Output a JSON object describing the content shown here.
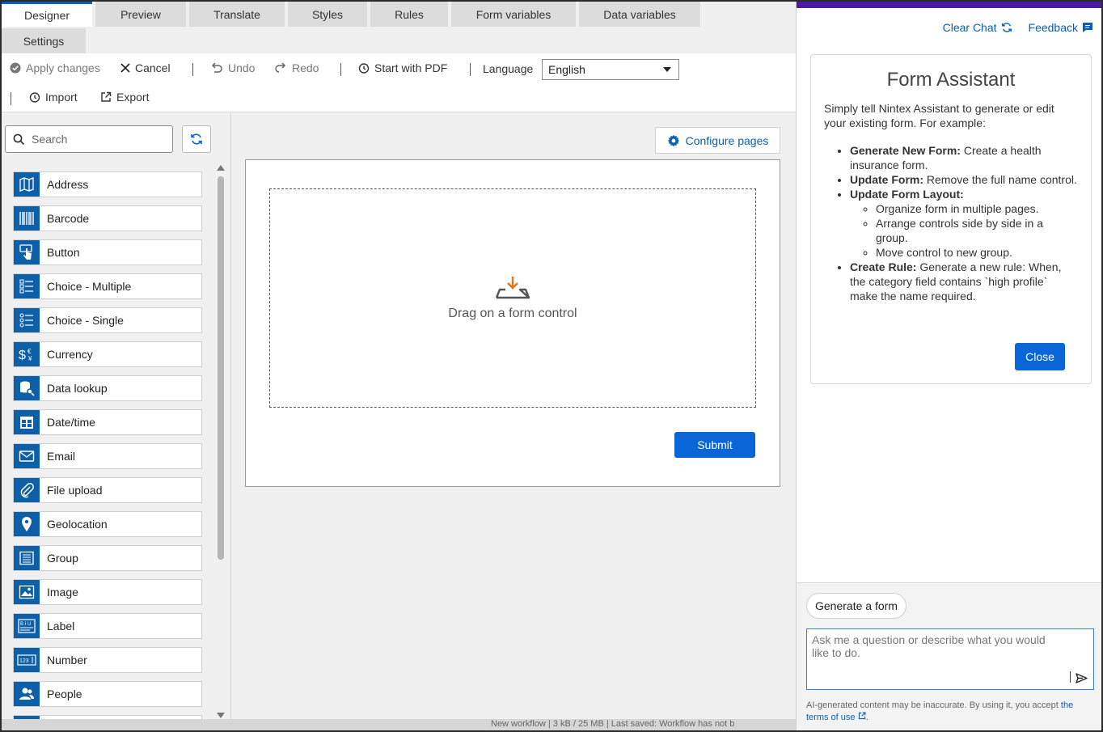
{
  "tabs": [
    {
      "label": "Designer",
      "active": true
    },
    {
      "label": "Preview"
    },
    {
      "label": "Translate"
    },
    {
      "label": "Styles"
    },
    {
      "label": "Rules"
    },
    {
      "label": "Form variables"
    },
    {
      "label": "Data variables"
    },
    {
      "label": "Settings"
    }
  ],
  "toolbar": {
    "apply": "Apply changes",
    "cancel": "Cancel",
    "undo": "Undo",
    "redo": "Redo",
    "start_pdf": "Start with PDF",
    "language_label": "Language",
    "language_value": "English",
    "import": "Import",
    "export": "Export"
  },
  "panel": {
    "search_placeholder": "Search",
    "controls": [
      "Address",
      "Barcode",
      "Button",
      "Choice - Multiple",
      "Choice - Single",
      "Currency",
      "Data lookup",
      "Date/time",
      "Email",
      "File upload",
      "Geolocation",
      "Group",
      "Image",
      "Label",
      "Number",
      "People"
    ]
  },
  "canvas": {
    "configure_pages": "Configure pages",
    "drop_text": "Drag on a form control",
    "submit": "Submit"
  },
  "status_bar": {
    "text": "New workflow  |  3 kB / 25 MB  |  Last saved: Workflow has not b"
  },
  "assistant": {
    "clear_chat": "Clear Chat",
    "feedback": "Feedback",
    "title": "Form Assistant",
    "intro": "Simply tell Nintex Assistant to generate or edit your existing form. For example:",
    "items": {
      "new_form_bold": "Generate New Form:",
      "new_form_text": " Create a health insurance form.",
      "update_form_bold": "Update Form:",
      "update_form_text": " Remove the full name control.",
      "layout_bold": "Update Form Layout:",
      "layout_sub": [
        "Organize form in multiple pages.",
        "Arrange controls side by side in a group.",
        "Move control to new group."
      ],
      "rule_bold": "Create Rule:",
      "rule_text": " Generate a new rule: When, the category field contains `high profile` make the name required."
    },
    "close": "Close",
    "chip": "Generate a form",
    "input_placeholder": "Ask me a question or describe what you would like to do.",
    "disclaimer": "AI-generated content may be inaccurate. By using it, you accept",
    "terms": "the terms of use"
  },
  "colors": {
    "accent": "#0a66d6",
    "control_icon_bg": "#0d5fa8",
    "assistant_header": "#4b1aa3",
    "drop_arrow": "#e8731a"
  }
}
